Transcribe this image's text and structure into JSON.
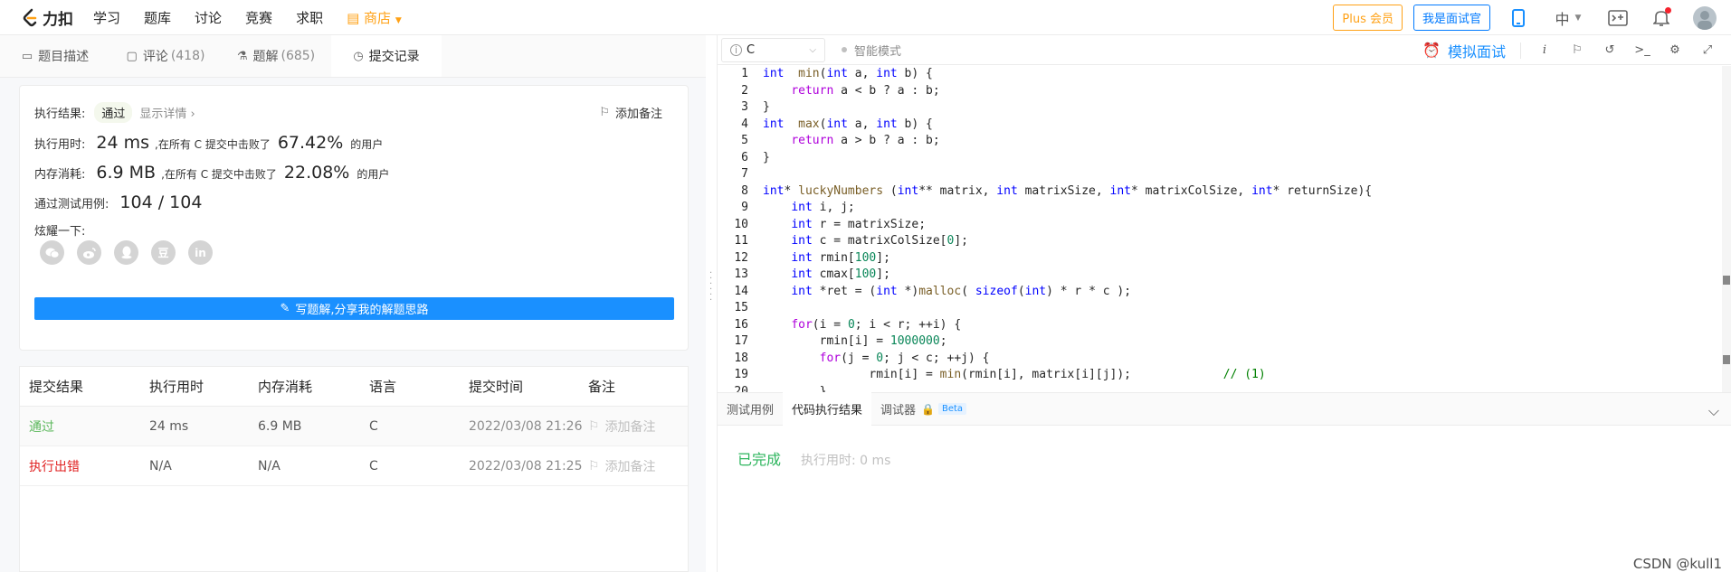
{
  "nav": {
    "logo": "力扣",
    "links": [
      "学习",
      "题库",
      "讨论",
      "竞赛",
      "求职"
    ],
    "store": "商店",
    "plus": "Plus 会员",
    "interviewer": "我是面试官",
    "lang": "中"
  },
  "tabs": [
    {
      "label": "题目描述",
      "count": ""
    },
    {
      "label": "评论",
      "count": "(418)"
    },
    {
      "label": "题解",
      "count": "(685)"
    },
    {
      "label": "提交记录",
      "count": ""
    }
  ],
  "result": {
    "label": "执行结果:",
    "status": "通过",
    "detail": "显示详情 ›",
    "add_note": "添加备注",
    "time_label": "执行用时:",
    "time_value": "24 ms",
    "time_desc": ",在所有 C 提交中击败了",
    "time_pct": "67.42%",
    "time_suffix": "的用户",
    "mem_label": "内存消耗:",
    "mem_value": "6.9 MB",
    "mem_desc": ",在所有 C 提交中击败了",
    "mem_pct": "22.08%",
    "mem_suffix": "的用户",
    "cases_label": "通过测试用例:",
    "cases_value": "104 / 104",
    "share_label": "炫耀一下:",
    "share_icons": [
      "wechat-icon",
      "weibo-icon",
      "qq-icon",
      "douban-icon",
      "linkedin-icon"
    ],
    "douban_glyph": "豆",
    "linkedin_glyph": "in",
    "write_button": "写题解,分享我的解题思路"
  },
  "table": {
    "headers": [
      "提交结果",
      "执行用时",
      "内存消耗",
      "语言",
      "提交时间",
      "备注"
    ],
    "rows": [
      {
        "status": "通过",
        "time": "24 ms",
        "mem": "6.9 MB",
        "lang": "C",
        "date": "2022/03/08 21:26",
        "note": "添加备注"
      },
      {
        "status": "执行出错",
        "time": "N/A",
        "mem": "N/A",
        "lang": "C",
        "date": "2022/03/08 21:25",
        "note": "添加备注"
      }
    ]
  },
  "editor": {
    "language": "C",
    "ai_mode": "智能模式",
    "mock_interview": "模拟面试"
  },
  "code_lines": [
    [
      [
        "kw",
        "int"
      ],
      [
        "",
        "  "
      ],
      [
        "fn",
        "min"
      ],
      [
        "",
        "("
      ],
      [
        "kw",
        "int"
      ],
      [
        "",
        " a, "
      ],
      [
        "kw",
        "int"
      ],
      [
        "",
        " b) {"
      ]
    ],
    [
      [
        "",
        " "
      ],
      [
        "kw2",
        "return"
      ],
      [
        "",
        " a < b ? a : b;"
      ]
    ],
    [
      [
        "",
        "}"
      ]
    ],
    [
      [
        "kw",
        "int"
      ],
      [
        "",
        "  "
      ],
      [
        "fn",
        "max"
      ],
      [
        "",
        "("
      ],
      [
        "kw",
        "int"
      ],
      [
        "",
        " a, "
      ],
      [
        "kw",
        "int"
      ],
      [
        "",
        " b) {"
      ]
    ],
    [
      [
        "",
        " "
      ],
      [
        "kw2",
        "return"
      ],
      [
        "",
        " a > b ? a : b;"
      ]
    ],
    [
      [
        "",
        "}"
      ]
    ],
    [
      [
        "",
        ""
      ]
    ],
    [
      [
        "kw",
        "int"
      ],
      [
        "",
        "* "
      ],
      [
        "fn",
        "luckyNumbers"
      ],
      [
        "",
        " ("
      ],
      [
        "kw",
        "int"
      ],
      [
        "",
        "** matrix, "
      ],
      [
        "kw",
        "int"
      ],
      [
        "",
        " matrixSize, "
      ],
      [
        "kw",
        "int"
      ],
      [
        "",
        "* matrixColSize, "
      ],
      [
        "kw",
        "int"
      ],
      [
        "",
        "* returnSize){"
      ]
    ],
    [
      [
        "",
        " "
      ],
      [
        "kw",
        "int"
      ],
      [
        "",
        " i, j;"
      ]
    ],
    [
      [
        "",
        " "
      ],
      [
        "kw",
        "int"
      ],
      [
        "",
        " r = matrixSize;"
      ]
    ],
    [
      [
        "",
        " "
      ],
      [
        "kw",
        "int"
      ],
      [
        "",
        " c = matrixColSize["
      ],
      [
        "num",
        "0"
      ],
      [
        "",
        "];"
      ]
    ],
    [
      [
        "",
        " "
      ],
      [
        "kw",
        "int"
      ],
      [
        "",
        " rmin["
      ],
      [
        "num",
        "100"
      ],
      [
        "",
        "];"
      ]
    ],
    [
      [
        "",
        " "
      ],
      [
        "kw",
        "int"
      ],
      [
        "",
        " cmax["
      ],
      [
        "num",
        "100"
      ],
      [
        "",
        "];"
      ]
    ],
    [
      [
        "",
        " "
      ],
      [
        "kw",
        "int"
      ],
      [
        "",
        " *ret = ("
      ],
      [
        "kw",
        "int"
      ],
      [
        "",
        " *)"
      ],
      [
        "fn",
        "malloc"
      ],
      [
        "",
        "( "
      ],
      [
        "kw",
        "sizeof"
      ],
      [
        "",
        "("
      ],
      [
        "kw",
        "int"
      ],
      [
        "",
        ") * r * c );"
      ]
    ],
    [
      [
        "",
        ""
      ]
    ],
    [
      [
        "",
        " "
      ],
      [
        "kw2",
        "for"
      ],
      [
        "",
        "(i = "
      ],
      [
        "num",
        "0"
      ],
      [
        "",
        "; i < r; ++i) {"
      ]
    ],
    [
      [
        "",
        "     rmin[i] = "
      ],
      [
        "num",
        "1000000"
      ],
      [
        "",
        ";"
      ]
    ],
    [
      [
        "",
        "     "
      ],
      [
        "kw2",
        "for"
      ],
      [
        "",
        "(j = "
      ],
      [
        "num",
        "0"
      ],
      [
        "",
        "; j < c; ++j) {"
      ]
    ],
    [
      [
        "",
        "         rmin[i] = "
      ],
      [
        "fn",
        "min"
      ],
      [
        "",
        "(rmin[i], matrix[i][j]);             "
      ],
      [
        "cm",
        "// (1)"
      ]
    ],
    [
      [
        "",
        "     }"
      ]
    ]
  ],
  "bottom": {
    "tabs": [
      "测试用例",
      "代码执行结果",
      "调试器"
    ],
    "beta": "Beta",
    "status": "已完成",
    "exec_time": "执行用时: 0 ms"
  },
  "watermark": "CSDN @kull1"
}
